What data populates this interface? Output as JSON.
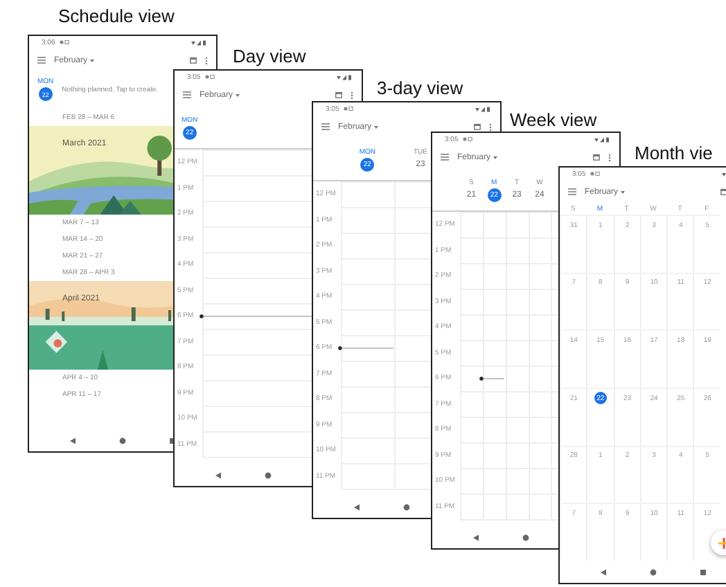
{
  "views": [
    {
      "kind": "schedule",
      "caption": "Schedule view",
      "status_time": "3:06",
      "month": "February",
      "today": {
        "weekday": "MON",
        "date": "22",
        "note": "Nothing planned. Tap to create."
      },
      "entries": [
        {
          "kind": "range",
          "text": "FEB 28 – MAR 6"
        },
        {
          "kind": "banner",
          "title": "March 2021"
        },
        {
          "kind": "range",
          "text": "MAR 7 – 13"
        },
        {
          "kind": "range",
          "text": "MAR 14 – 20"
        },
        {
          "kind": "range",
          "text": "MAR 21 – 27"
        },
        {
          "kind": "range",
          "text": "MAR 28 – APR 3"
        },
        {
          "kind": "banner",
          "title": "April 2021"
        },
        {
          "kind": "range",
          "text": "APR 4 – 10"
        },
        {
          "kind": "range",
          "text": "APR 11 – 17"
        }
      ]
    },
    {
      "kind": "day",
      "caption": "Day view",
      "status_time": "3:05",
      "month": "February",
      "days": [
        {
          "weekday": "MON",
          "date": "22",
          "selected": true
        }
      ],
      "hours": [
        {
          "label": "12 PM",
          "now": false
        },
        {
          "label": "1 PM",
          "now": false
        },
        {
          "label": "2 PM",
          "now": false
        },
        {
          "label": "3 PM",
          "now": false
        },
        {
          "label": "4 PM",
          "now": false
        },
        {
          "label": "5 PM",
          "now": false
        },
        {
          "label": "6 PM",
          "now": true
        },
        {
          "label": "7 PM",
          "now": false
        },
        {
          "label": "8 PM",
          "now": false
        },
        {
          "label": "9 PM",
          "now": false
        },
        {
          "label": "10 PM",
          "now": false
        },
        {
          "label": "11 PM",
          "now": false
        }
      ]
    },
    {
      "kind": "three_day",
      "caption": "3-day view",
      "status_time": "3:05",
      "month": "February",
      "days": [
        {
          "weekday": "MON",
          "date": "22",
          "selected": true
        },
        {
          "weekday": "TUE",
          "date": "23",
          "selected": false
        }
      ],
      "hours": [
        {
          "label": "12 PM",
          "now": false
        },
        {
          "label": "1 PM",
          "now": false
        },
        {
          "label": "2 PM",
          "now": false
        },
        {
          "label": "3 PM",
          "now": false
        },
        {
          "label": "4 PM",
          "now": false
        },
        {
          "label": "5 PM",
          "now": false
        },
        {
          "label": "6 PM",
          "now": true
        },
        {
          "label": "7 PM",
          "now": false
        },
        {
          "label": "8 PM",
          "now": false
        },
        {
          "label": "9 PM",
          "now": false
        },
        {
          "label": "10 PM",
          "now": false
        },
        {
          "label": "11 PM",
          "now": false
        }
      ]
    },
    {
      "kind": "week",
      "caption": "Week view",
      "status_time": "3:05",
      "month": "February",
      "days": [
        {
          "weekday": "S",
          "date": "21",
          "selected": false
        },
        {
          "weekday": "M",
          "date": "22",
          "selected": true
        },
        {
          "weekday": "T",
          "date": "23",
          "selected": false
        },
        {
          "weekday": "W",
          "date": "24",
          "selected": false
        }
      ],
      "hours": [
        {
          "label": "12 PM",
          "now": false
        },
        {
          "label": "1 PM",
          "now": false
        },
        {
          "label": "2 PM",
          "now": false
        },
        {
          "label": "3 PM",
          "now": false
        },
        {
          "label": "4 PM",
          "now": false
        },
        {
          "label": "5 PM",
          "now": false
        },
        {
          "label": "6 PM",
          "now": true
        },
        {
          "label": "7 PM",
          "now": false
        },
        {
          "label": "8 PM",
          "now": false
        },
        {
          "label": "9 PM",
          "now": false
        },
        {
          "label": "10 PM",
          "now": false
        },
        {
          "label": "11 PM",
          "now": false
        }
      ]
    },
    {
      "kind": "month",
      "caption": "Month vie",
      "status_time": "3:05",
      "month": "February",
      "weekdays": [
        {
          "label": "S",
          "today": false
        },
        {
          "label": "M",
          "today": true
        },
        {
          "label": "T",
          "today": false
        },
        {
          "label": "W",
          "today": false
        },
        {
          "label": "T",
          "today": false
        },
        {
          "label": "F",
          "today": false
        }
      ],
      "weeks": [
        [
          {
            "date": "31",
            "selected": false
          },
          {
            "date": "1",
            "selected": false
          },
          {
            "date": "2",
            "selected": false
          },
          {
            "date": "3",
            "selected": false
          },
          {
            "date": "4",
            "selected": false
          },
          {
            "date": "5",
            "selected": false
          }
        ],
        [
          {
            "date": "7",
            "selected": false
          },
          {
            "date": "8",
            "selected": false
          },
          {
            "date": "9",
            "selected": false
          },
          {
            "date": "10",
            "selected": false
          },
          {
            "date": "11",
            "selected": false
          },
          {
            "date": "12",
            "selected": false
          }
        ],
        [
          {
            "date": "14",
            "selected": false
          },
          {
            "date": "15",
            "selected": false
          },
          {
            "date": "16",
            "selected": false
          },
          {
            "date": "17",
            "selected": false
          },
          {
            "date": "18",
            "selected": false
          },
          {
            "date": "19",
            "selected": false
          }
        ],
        [
          {
            "date": "21",
            "selected": false
          },
          {
            "date": "22",
            "selected": true
          },
          {
            "date": "23",
            "selected": false
          },
          {
            "date": "24",
            "selected": false
          },
          {
            "date": "25",
            "selected": false
          },
          {
            "date": "26",
            "selected": false
          }
        ],
        [
          {
            "date": "28",
            "selected": false
          },
          {
            "date": "1",
            "selected": false
          },
          {
            "date": "2",
            "selected": false
          },
          {
            "date": "3",
            "selected": false
          },
          {
            "date": "4",
            "selected": false
          },
          {
            "date": "5",
            "selected": false
          }
        ],
        [
          {
            "date": "7",
            "selected": false
          },
          {
            "date": "8",
            "selected": false
          },
          {
            "date": "9",
            "selected": false
          },
          {
            "date": "10",
            "selected": false
          },
          {
            "date": "11",
            "selected": false
          },
          {
            "date": "12",
            "selected": false
          }
        ]
      ]
    }
  ]
}
